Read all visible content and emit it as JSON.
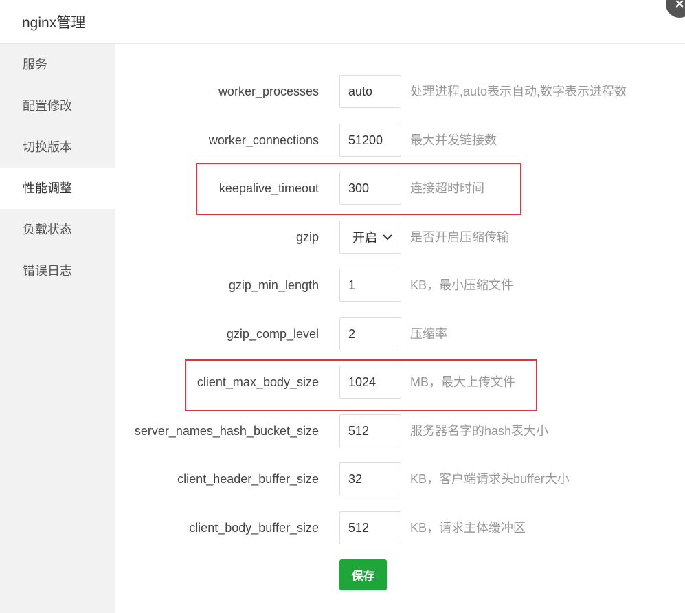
{
  "dialog": {
    "title": "nginx管理",
    "close_label": "×"
  },
  "sidebar": {
    "items": [
      {
        "label": "服务"
      },
      {
        "label": "配置修改"
      },
      {
        "label": "切换版本"
      },
      {
        "label": "性能调整",
        "active": true
      },
      {
        "label": "负载状态"
      },
      {
        "label": "错误日志"
      }
    ]
  },
  "form": {
    "rows": [
      {
        "label": "worker_processes",
        "value": "auto",
        "hint": "处理进程,auto表示自动,数字表示进程数"
      },
      {
        "label": "worker_connections",
        "value": "51200",
        "hint": "最大并发链接数"
      },
      {
        "label": "keepalive_timeout",
        "value": "300",
        "hint": "连接超时时间",
        "highlighted": true
      },
      {
        "label": "gzip",
        "value": "开启",
        "hint": "是否开启压缩传输",
        "type": "select"
      },
      {
        "label": "gzip_min_length",
        "value": "1",
        "hint": "KB，最小压缩文件"
      },
      {
        "label": "gzip_comp_level",
        "value": "2",
        "hint": "压缩率"
      },
      {
        "label": "client_max_body_size",
        "value": "1024",
        "hint": "MB，最大上传文件",
        "highlighted": true
      },
      {
        "label": "server_names_hash_bucket_size",
        "value": "512",
        "hint": "服务器名字的hash表大小"
      },
      {
        "label": "client_header_buffer_size",
        "value": "32",
        "hint": "KB，客户端请求头buffer大小"
      },
      {
        "label": "client_body_buffer_size",
        "value": "512",
        "hint": "KB，请求主体缓冲区"
      }
    ],
    "save_label": "保存"
  },
  "colors": {
    "accent": "#20a53a",
    "highlight": "#d9363e"
  }
}
